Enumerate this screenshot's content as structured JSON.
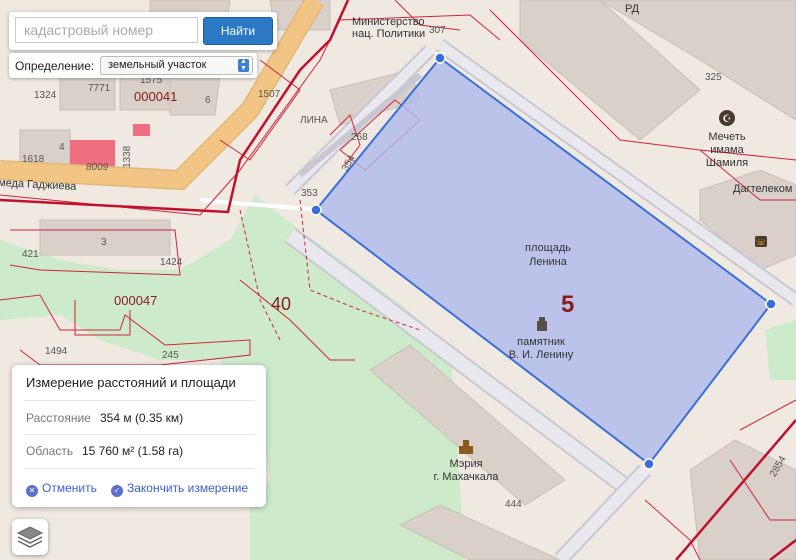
{
  "search": {
    "placeholder": "кадастровый номер",
    "button_label": "Найти"
  },
  "definition": {
    "label": "Определение:",
    "selected": "земельный участок"
  },
  "measure": {
    "title": "Измерение расстояний и площади",
    "distance_label": "Расстояние",
    "distance_value": "354 м (0.35 км)",
    "area_label": "Область",
    "area_value": "15 760 м² (1.58 га)",
    "cancel_label": "Отменить",
    "finish_label": "Закончить измерение"
  },
  "map": {
    "street_label": "Имеда Гаджиева",
    "parcel_numbers": [
      "1575",
      "000041",
      "1324",
      "7771",
      "6",
      "1507",
      "ЛИНА",
      "268",
      "354",
      "353",
      "307",
      "325",
      "1618",
      "4",
      "8009",
      "1338",
      "3",
      "421",
      "1424",
      "000047",
      "245",
      "1494",
      "444",
      "2854",
      "РД",
      "Дагтелеком"
    ],
    "block_numbers": [
      "40",
      "5"
    ],
    "pois": {
      "ministry": [
        "Министерство",
        "нац. Политики"
      ],
      "mosque": [
        "Мечеть",
        "имама",
        "Шамиля"
      ],
      "square": [
        "площадь",
        "Ленина"
      ],
      "monument": [
        "памятник",
        "В. И. Ленину"
      ],
      "mayor": [
        "Мэрия",
        "г. Махачкала"
      ]
    }
  },
  "colors": {
    "measure_fill": "#aeb9ee",
    "measure_line": "#3a6fd8",
    "parcel_border": "#d0243a",
    "park": "#cdebcb",
    "road": "#f3c584"
  }
}
